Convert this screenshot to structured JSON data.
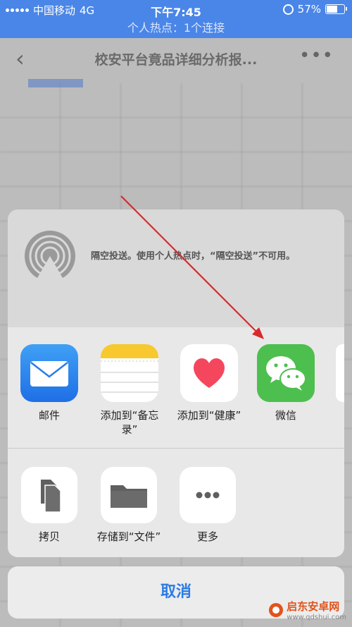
{
  "status_bar": {
    "carrier": "中国移动",
    "network": "4G",
    "time": "下午7:45",
    "battery_text": "57%",
    "battery_level": 0.57
  },
  "hotspot_banner": "个人热点：1个连接",
  "background_page": {
    "title": "校安平台竟品详细分析报...",
    "back_glyph": "‹",
    "more_glyph": "•••"
  },
  "share_sheet": {
    "airdrop_text": "隔空投送。使用个人热点时，“隔空投送”不可用。",
    "apps": [
      {
        "label": "邮件",
        "icon": "mail-icon"
      },
      {
        "label": "添加到“备忘录”",
        "icon": "notes-icon"
      },
      {
        "label": "添加到“健康”",
        "icon": "health-icon"
      },
      {
        "label": "微信",
        "icon": "wechat-icon"
      }
    ],
    "actions": [
      {
        "label": "拷贝",
        "icon": "copy-icon"
      },
      {
        "label": "存储到“文件”",
        "icon": "folder-icon"
      },
      {
        "label": "更多",
        "icon": "more-icon"
      }
    ],
    "cancel_label": "取消"
  },
  "watermark": {
    "name": "启东安卓网",
    "url": "www.qdshui.com"
  },
  "colors": {
    "status_bar": "#4a86e8",
    "cancel_text": "#2c7be5",
    "annotation_arrow": "#d62b2b",
    "wechat_green": "#4dbf4f"
  }
}
